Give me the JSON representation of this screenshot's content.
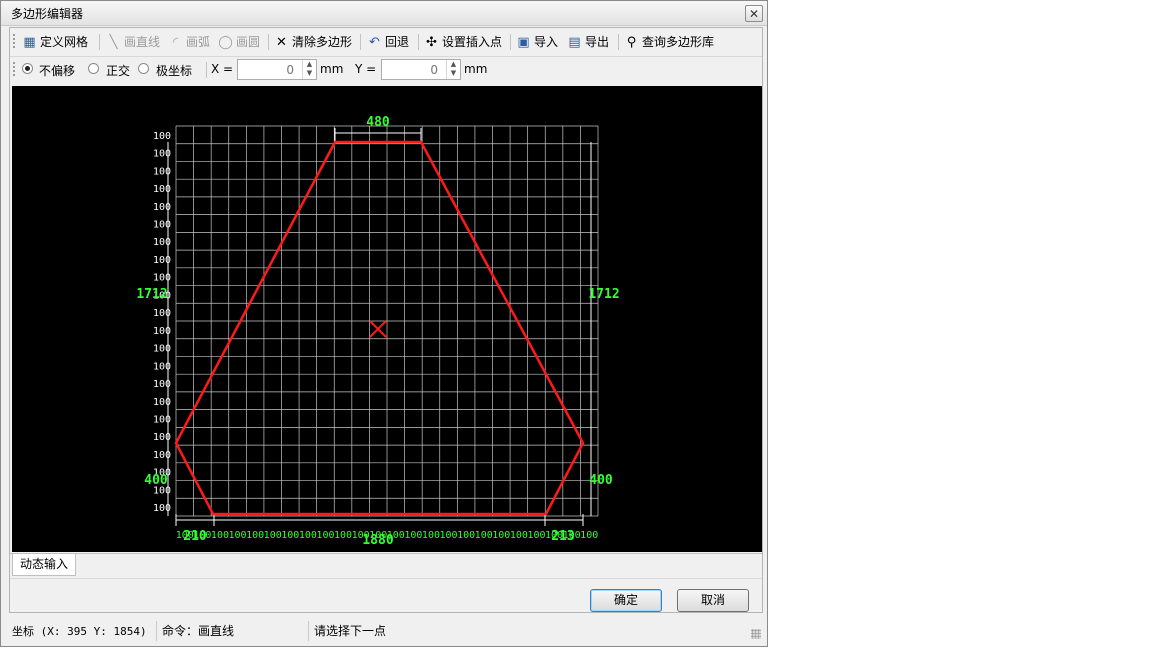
{
  "window": {
    "title": "多边形编辑器",
    "close_glyph": "✕"
  },
  "toolbar": {
    "define_grid": "定义网格",
    "draw_line": "画直线",
    "draw_arc": "画弧",
    "draw_circle": "画圆",
    "clear_polygon": "清除多边形",
    "undo": "回退",
    "set_insert_point": "设置插入点",
    "import": "导入",
    "export": "导出",
    "query_library": "查询多边形库"
  },
  "options": {
    "mode_no_offset": "不偏移",
    "mode_ortho": "正交",
    "mode_polar": "极坐标",
    "selected_mode": "不偏移",
    "x_label": "X =",
    "x_value": "0",
    "y_label": "Y =",
    "y_value": "0",
    "unit": "mm"
  },
  "canvas": {
    "grid_label": "100",
    "dim_top": "480",
    "dim_left": "1712",
    "dim_right": "1712",
    "dim_left_low": "400",
    "dim_right_low": "400",
    "dim_bottom": "1880",
    "dim_bottom_left": "210",
    "dim_bottom_right": "213",
    "colors": {
      "background": "#000000",
      "grid": "#c8c8c8",
      "polygon": "#ff1a1a",
      "dimension": "#33ff33",
      "marker": "#ff1a1a"
    }
  },
  "tabs": {
    "dynamic_input": "动态输入"
  },
  "buttons": {
    "ok": "确定",
    "cancel": "取消"
  },
  "statusbar": {
    "coords": "坐标 (X: 395 Y: 1854)",
    "command": "命令：画直线",
    "prompt": "请选择下一点"
  }
}
